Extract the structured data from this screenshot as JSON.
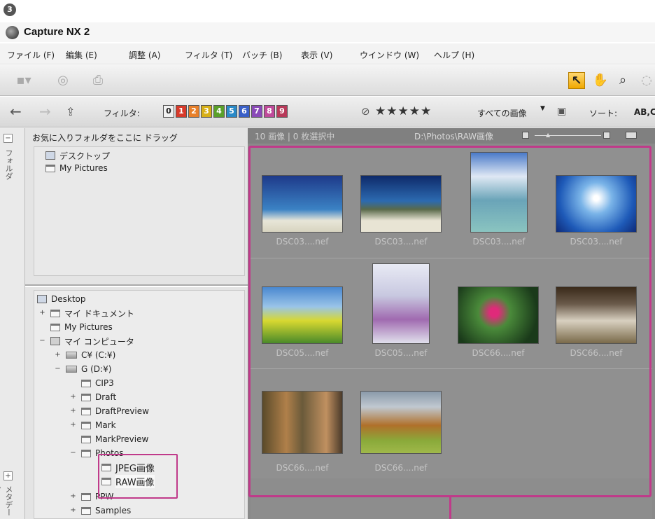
{
  "step_number": "3",
  "window": {
    "title": "Capture NX 2"
  },
  "menu": [
    "ファイル (F)",
    "編集 (E)",
    "調整 (A)",
    "フィルタ (T)",
    "バッチ (B)",
    "表示 (V)",
    "ウインドウ (W)",
    "ヘルプ (H)"
  ],
  "toolbar2": {
    "filter_label": "フィルタ:",
    "ratings": [
      "0",
      "1",
      "2",
      "3",
      "4",
      "5",
      "6",
      "7",
      "8",
      "9"
    ],
    "rating_colors": [
      "#f2f2f2",
      "#d83a2a",
      "#e8802a",
      "#d8b018",
      "#5aa02a",
      "#2a8ac8",
      "#3a60c8",
      "#8a4ab8",
      "#c04a9a",
      "#b83a5a"
    ],
    "stars": "★★★★★",
    "all_images": "すべての画像",
    "sort_label": "ソート:",
    "sort_value": "AB,C"
  },
  "left_strip": {
    "folders_tab": "フォルダ",
    "metadata_tab": "メタデータ"
  },
  "favorites": {
    "header": "お気に入りフォルダをここに ドラッグ",
    "items": [
      "デスクトップ",
      "My Pictures"
    ]
  },
  "tree": {
    "items": [
      {
        "label": "Desktop",
        "expander": ""
      },
      {
        "label": "マイ ドキュメント",
        "expander": "+"
      },
      {
        "label": "My Pictures",
        "expander": ""
      },
      {
        "label": "マイ コンピュータ",
        "expander": "−"
      },
      {
        "label": "C¥ (C:¥)",
        "expander": "+"
      },
      {
        "label": "G (D:¥)",
        "expander": "−"
      },
      {
        "label": "CIP3",
        "expander": ""
      },
      {
        "label": "Draft",
        "expander": "+"
      },
      {
        "label": "DraftPreview",
        "expander": "+"
      },
      {
        "label": "Mark",
        "expander": "+"
      },
      {
        "label": "MarkPreview",
        "expander": ""
      },
      {
        "label": "Photos",
        "expander": "−"
      },
      {
        "label": "JPEG画像",
        "expander": ""
      },
      {
        "label": "RAW画像",
        "expander": ""
      },
      {
        "label": "PPW",
        "expander": "+"
      },
      {
        "label": "Samples",
        "expander": "+"
      }
    ]
  },
  "browser": {
    "count": "10 画像 | 0 枚選択中",
    "path": "D:\\Photos\\RAW画像",
    "thumbnails": [
      "DSC03....nef",
      "DSC03....nef",
      "DSC03....nef",
      "DSC03....nef",
      "DSC05....nef",
      "DSC05....nef",
      "DSC66....nef",
      "DSC66....nef",
      "DSC66....nef",
      "DSC66....nef"
    ]
  }
}
